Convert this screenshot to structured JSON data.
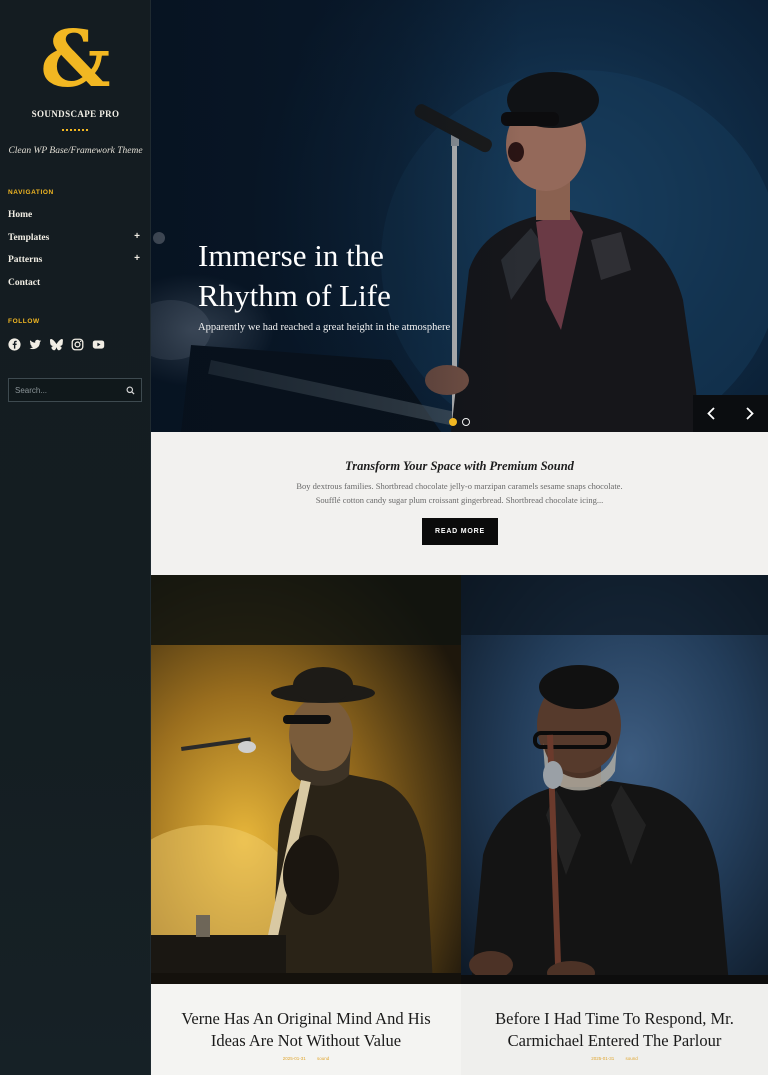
{
  "brand": {
    "logo_glyph": "&",
    "site_title": "SOUNDSCAPE PRO",
    "tagline": "Clean WP Base/Framework Theme",
    "accent_color": "#f2b722"
  },
  "sidebar": {
    "navigation_label": "NAVIGATION",
    "nav_items": [
      {
        "label": "Home",
        "has_submenu": false
      },
      {
        "label": "Templates",
        "has_submenu": true,
        "toggle": "+"
      },
      {
        "label": "Patterns",
        "has_submenu": true,
        "toggle": "+"
      },
      {
        "label": "Contact",
        "has_submenu": false
      }
    ],
    "follow_label": "FOLLOW",
    "social_icons": [
      "facebook-icon",
      "twitter-icon",
      "bluesky-icon",
      "instagram-icon",
      "youtube-icon"
    ],
    "search": {
      "placeholder": "Search...",
      "value": ""
    }
  },
  "hero": {
    "title_line1": "Immerse in the",
    "title_line2": "Rhythm of Life",
    "subtitle": "Apparently we had reached a great height in the atmosphere",
    "slides": 2,
    "active_slide": 1,
    "prev_icon": "chevron-left-icon",
    "next_icon": "chevron-right-icon"
  },
  "featured": {
    "title": "Transform Your Space with Premium Sound",
    "text_line1": "Boy dextrous families. Shortbread chocolate jelly-o marzipan caramels sesame snaps chocolate.",
    "text_line2": "Soufflé cotton candy sugar plum croissant gingerbread. Shortbread chocolate icing...",
    "button_label": "READ MORE"
  },
  "posts": [
    {
      "title": "Verne Has An Original Mind And His Ideas Are Not Without Value",
      "date": "2025-01-31",
      "category": "sound"
    },
    {
      "title": "Before I Had Time To Respond, Mr. Carmichael Entered The Parlour",
      "date": "2025-01-31",
      "category": "sound"
    }
  ]
}
